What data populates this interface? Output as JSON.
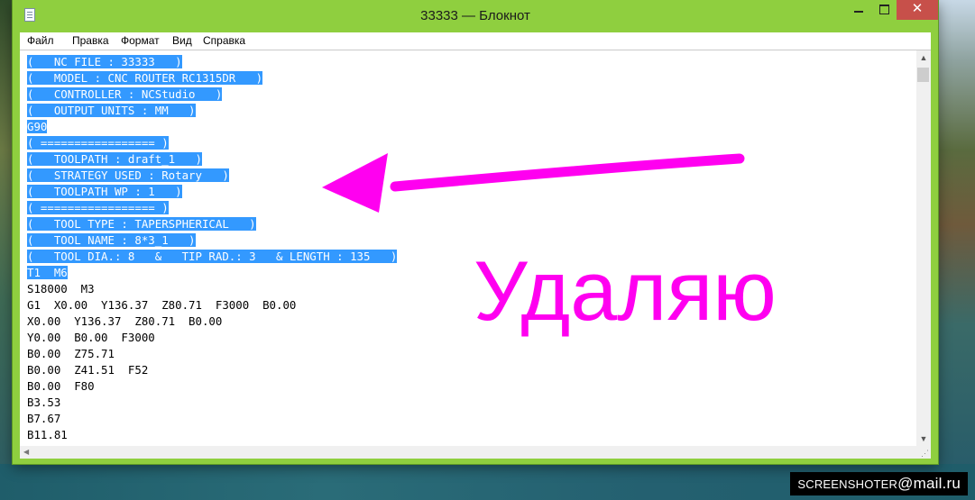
{
  "window": {
    "title": "33333 — Блокнот",
    "close_glyph": "✕"
  },
  "menu": [
    "Файл",
    "Правка",
    "Формат",
    "Вид",
    "Справка"
  ],
  "lines": [
    {
      "text": "(   NC FILE : 33333   )",
      "selected": true
    },
    {
      "text": "(   MODEL : CNC ROUTER RC1315DR   )",
      "selected": true
    },
    {
      "text": "(   CONTROLLER : NCStudio   )",
      "selected": true
    },
    {
      "text": "(   OUTPUT UNITS : MM   )",
      "selected": true
    },
    {
      "text": "G90",
      "selected": true
    },
    {
      "text": "( ================= )",
      "selected": true
    },
    {
      "text": "(   TOOLPATH : draft_1   )",
      "selected": true
    },
    {
      "text": "(   STRATEGY USED : Rotary   )",
      "selected": true
    },
    {
      "text": "(   TOOLPATH WP : 1   )",
      "selected": true
    },
    {
      "text": "( ================= )",
      "selected": true
    },
    {
      "text": "(   TOOL TYPE : TAPERSPHERICAL   )",
      "selected": true
    },
    {
      "text": "(   TOOL NAME : 8*3_1   )",
      "selected": true
    },
    {
      "text": "(   TOOL DIA.: 8   &   TIP RAD.: 3   & LENGTH : 135   )",
      "selected": true
    },
    {
      "text": "T1  M6",
      "selected": true
    },
    {
      "text": "S18000  M3",
      "selected": false
    },
    {
      "text": "G1  X0.00  Y136.37  Z80.71  F3000  B0.00",
      "selected": false
    },
    {
      "text": "X0.00  Y136.37  Z80.71  B0.00",
      "selected": false
    },
    {
      "text": "Y0.00  B0.00  F3000",
      "selected": false
    },
    {
      "text": "B0.00  Z75.71",
      "selected": false
    },
    {
      "text": "B0.00  Z41.51  F52",
      "selected": false
    },
    {
      "text": "B0.00  F80",
      "selected": false
    },
    {
      "text": "B3.53",
      "selected": false
    },
    {
      "text": "B7.67",
      "selected": false
    },
    {
      "text": "B11.81",
      "selected": false
    }
  ],
  "annotation": {
    "label": "Удаляю",
    "color": "#ff00f0"
  },
  "watermark": {
    "prefix": "SCREENSHOTER",
    "at": "@",
    "domain": "mail.ru"
  },
  "icons": {
    "app": "notepad-icon",
    "minimize": "minimize-icon",
    "maximize": "maximize-icon",
    "close": "close-icon"
  }
}
